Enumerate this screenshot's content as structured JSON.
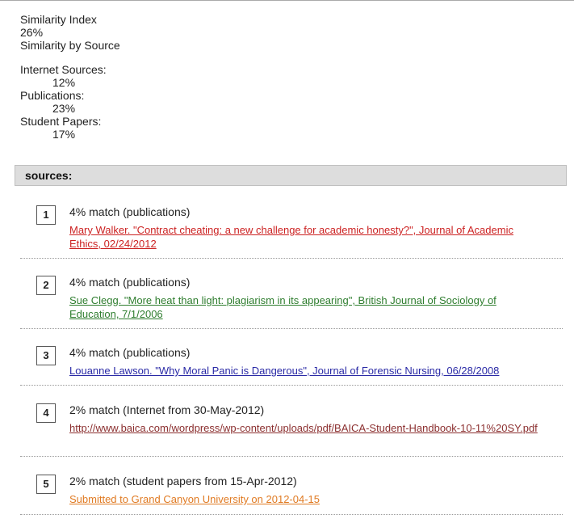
{
  "summary": {
    "similarity_index_label": "Similarity Index",
    "similarity_index_value": "26%",
    "similarity_by_source_label": "Similarity by Source",
    "internet_label": "Internet Sources:",
    "internet_value": "12%",
    "publications_label": "Publications:",
    "publications_value": "23%",
    "student_label": "Student Papers:",
    "student_value": "17%"
  },
  "sources_header": "sources:",
  "sources": [
    {
      "number": "1",
      "match": "4% match (publications)",
      "link": "Mary Walker. \"Contract cheating: a new challenge for academic honesty?\", Journal of Academic Ethics, 02/24/2012",
      "color": "#cc2222"
    },
    {
      "number": "2",
      "match": "4% match (publications)",
      "link": "Sue Clegg. \"More heat than light: plagiarism in its appearing\", British Journal of Sociology of Education, 7/1/2006",
      "color": "#2e7d2e"
    },
    {
      "number": "3",
      "match": "4% match (publications)",
      "link": "Louanne Lawson. \"Why Moral Panic is Dangerous\", Journal of Forensic Nursing, 06/28/2008",
      "color": "#2a2aa6"
    },
    {
      "number": "4",
      "match": "2% match (Internet from 30-May-2012)",
      "link": "http://www.baica.com/wordpress/wp-content/uploads/pdf/BAICA-Student-Handbook-10-11%20SY.pdf",
      "color": "#8b2f2f"
    },
    {
      "number": "5",
      "match": "2% match (student papers from 15-Apr-2012)",
      "link": "Submitted to Grand Canyon University on 2012-04-15",
      "color": "#e07a22"
    }
  ]
}
